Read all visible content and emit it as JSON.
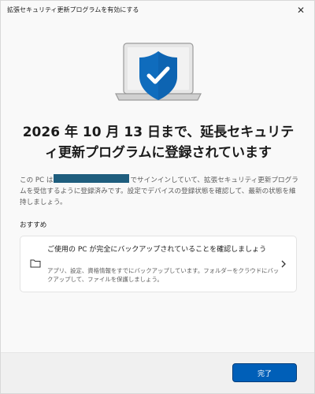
{
  "window": {
    "title": "拡張セキュリティ更新プログラムを有効にする",
    "close_glyph": "✕"
  },
  "main": {
    "heading": "2026 年 10 月 13 日まで、延長セキュリティ更新プログラムに登録されています",
    "body_prefix": "この PC は",
    "body_suffix": "でサインインしていて、拡張セキュリティ更新プログラムを受信するように登録済みです。設定でデバイスの登録状態を確認して、最新の状態を維持しましょう。"
  },
  "recommend": {
    "label": "おすすめ",
    "card": {
      "title": "ご使用の PC が完全にバックアップされていることを確認しましょう",
      "description": "アプリ、設定、資格情報をすでにバックアップしています。フォルダーをクラウドにバックアップして、ファイルを保護しましょう。",
      "icon": "folder-icon"
    }
  },
  "footer": {
    "done_label": "完了"
  },
  "colors": {
    "accent": "#005fb8",
    "shield": "#0f6cbd",
    "redaction": "#1f5e7e"
  }
}
